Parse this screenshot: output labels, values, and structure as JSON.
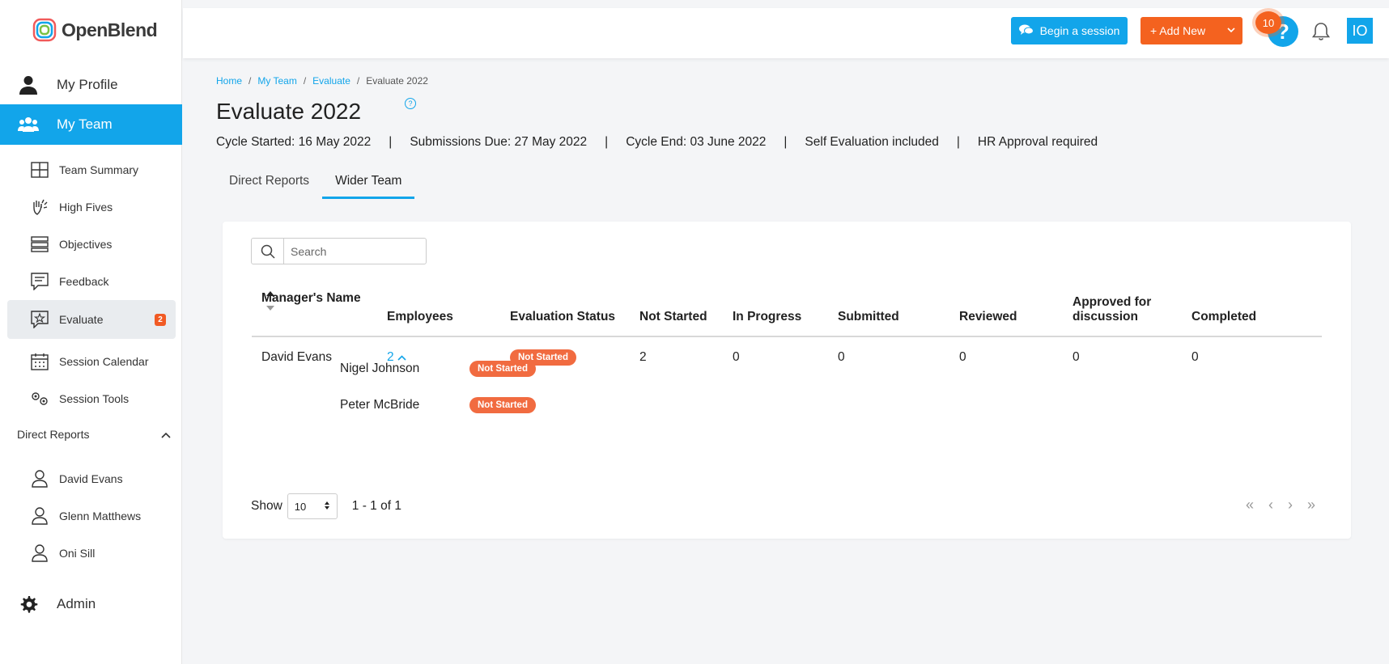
{
  "brand": {
    "name": "OpenBlend"
  },
  "sidebar": {
    "my_profile": "My Profile",
    "my_team": "My Team",
    "items": [
      {
        "label": "Team Summary",
        "icon": "grid-icon"
      },
      {
        "label": "High Fives",
        "icon": "high-five-icon"
      },
      {
        "label": "Objectives",
        "icon": "objectives-icon"
      },
      {
        "label": "Feedback",
        "icon": "feedback-icon"
      },
      {
        "label": "Evaluate",
        "icon": "evaluate-icon",
        "badge": "2"
      },
      {
        "label": "Session Calendar",
        "icon": "calendar-icon"
      },
      {
        "label": "Session Tools",
        "icon": "tools-icon"
      }
    ],
    "direct_reports_heading": "Direct Reports",
    "direct_reports": [
      "David Evans",
      "Glenn Matthews",
      "Oni Sill"
    ],
    "admin": "Admin"
  },
  "topbar": {
    "begin_session": "Begin a session",
    "add_new": "+ Add New",
    "help_count": "10",
    "avatar_initials": "IO"
  },
  "breadcrumb": [
    "Home",
    "My Team",
    "Evaluate",
    "Evaluate 2022"
  ],
  "page": {
    "title": "Evaluate 2022",
    "cycle_started": "Cycle Started: 16 May 2022",
    "submissions_due": "Submissions Due: 27 May 2022",
    "cycle_end": "Cycle End: 03 June 2022",
    "self_eval": "Self Evaluation included",
    "hr_approval": "HR Approval required"
  },
  "tabs": [
    "Direct Reports",
    "Wider Team"
  ],
  "search": {
    "placeholder": "Search"
  },
  "table": {
    "headers": [
      "Manager's Name",
      "Employees",
      "Evaluation Status",
      "Not Started",
      "In Progress",
      "Submitted",
      "Reviewed",
      "Approved for discussion",
      "Completed"
    ],
    "rows": [
      {
        "manager": "David Evans",
        "employees": "2",
        "status": "Not Started",
        "not_started": "2",
        "in_progress": "0",
        "submitted": "0",
        "reviewed": "0",
        "approved": "0",
        "completed": "0"
      }
    ],
    "sub_rows": [
      {
        "name": "Nigel Johnson",
        "status": "Not Started"
      },
      {
        "name": "Peter McBride",
        "status": "Not Started"
      }
    ]
  },
  "pagination": {
    "show_label": "Show",
    "page_size": "10",
    "range": "1 - 1 of 1"
  },
  "colors": {
    "accent": "#12a5ea",
    "orange": "#f4621f",
    "badge": "#f16b40"
  }
}
